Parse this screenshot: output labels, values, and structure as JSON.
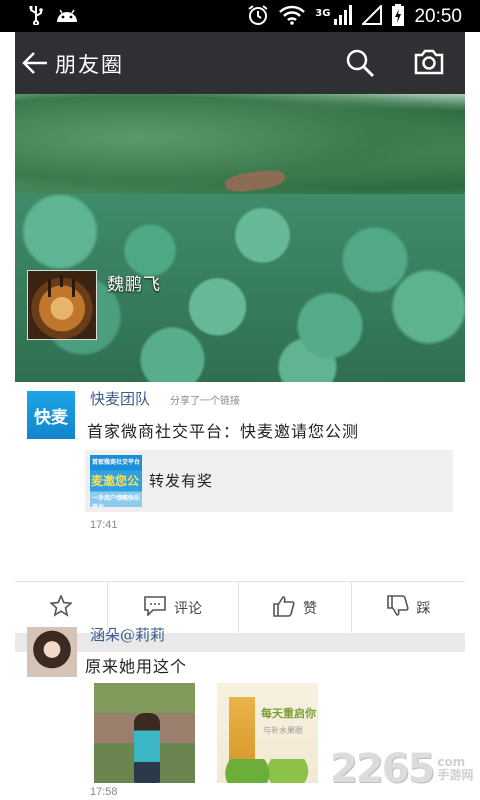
{
  "status_bar": {
    "network": "3G",
    "time": "20:50"
  },
  "action_bar": {
    "title": "朋友圈",
    "icons": [
      "back-arrow-icon",
      "search-icon",
      "camera-icon"
    ]
  },
  "cover": {
    "user_name": "魏鹏飞"
  },
  "post1": {
    "author": "快麦团队",
    "logo_text": "快麦",
    "action_text": "分享了一个链接",
    "text": "首家微商社交平台：快麦邀请您公测",
    "link": {
      "thumb_top": "首家微商社交平台",
      "thumb_middle": "麦邀您公",
      "thumb_bottom": "一手用户领略快乐平台",
      "title": "转发有奖"
    },
    "time": "17:41"
  },
  "actions": {
    "comment_label": "评论",
    "like_label": "赞",
    "dislike_label": "踩"
  },
  "post2": {
    "author": "涵朵@莉莉",
    "text": "原来她用这个",
    "photo2_text": "每天重启你",
    "photo2_subtext": "与补水果眼",
    "time": "17:58"
  },
  "watermark": {
    "number": "2265",
    "dot": ".",
    "line1": "com",
    "line2": "手游网"
  },
  "colors": {
    "status_bar": "#000000",
    "action_bar": "#2e3033",
    "author_link": "#3b5c8f",
    "link_card_bg": "#efefef"
  }
}
